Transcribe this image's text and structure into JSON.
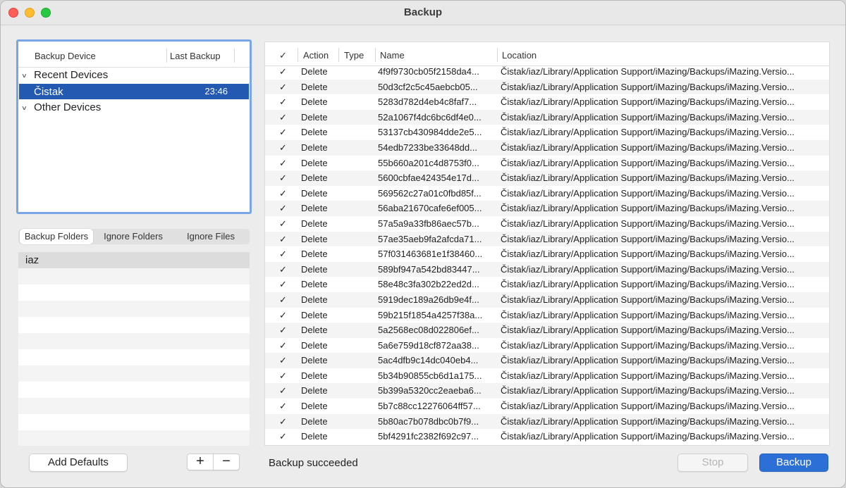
{
  "window": {
    "title": "Backup"
  },
  "devices": {
    "col_device": "Backup Device",
    "col_last_backup": "Last Backup",
    "recent_group": "Recent Devices",
    "selected_device": {
      "name": "Čistak",
      "time": "23:46"
    },
    "other_group": "Other Devices"
  },
  "tabs": [
    "Backup Folders",
    "Ignore Folders",
    "Ignore Files"
  ],
  "folders": [
    "iaz"
  ],
  "buttons": {
    "add_defaults": "Add Defaults",
    "plus": "+",
    "minus": "−",
    "stop": "Stop",
    "backup": "Backup"
  },
  "table": {
    "headers": {
      "check": "✓",
      "action": "Action",
      "type": "Type",
      "name": "Name",
      "location": "Location"
    },
    "rows": [
      {
        "check": "✓",
        "action": "Delete",
        "name": "4f9f9730cb05f2158da4...",
        "location": "Čistak/iaz/Library/Application Support/iMazing/Backups/iMazing.Versio..."
      },
      {
        "check": "✓",
        "action": "Delete",
        "name": "50d3cf2c5c45aebcb05...",
        "location": "Čistak/iaz/Library/Application Support/iMazing/Backups/iMazing.Versio..."
      },
      {
        "check": "✓",
        "action": "Delete",
        "name": "5283d782d4eb4c8faf7...",
        "location": "Čistak/iaz/Library/Application Support/iMazing/Backups/iMazing.Versio..."
      },
      {
        "check": "✓",
        "action": "Delete",
        "name": "52a1067f4dc6bc6df4e0...",
        "location": "Čistak/iaz/Library/Application Support/iMazing/Backups/iMazing.Versio..."
      },
      {
        "check": "✓",
        "action": "Delete",
        "name": "53137cb430984dde2e5...",
        "location": "Čistak/iaz/Library/Application Support/iMazing/Backups/iMazing.Versio..."
      },
      {
        "check": "✓",
        "action": "Delete",
        "name": "54edb7233be33648dd...",
        "location": "Čistak/iaz/Library/Application Support/iMazing/Backups/iMazing.Versio..."
      },
      {
        "check": "✓",
        "action": "Delete",
        "name": "55b660a201c4d8753f0...",
        "location": "Čistak/iaz/Library/Application Support/iMazing/Backups/iMazing.Versio..."
      },
      {
        "check": "✓",
        "action": "Delete",
        "name": "5600cbfae424354e17d...",
        "location": "Čistak/iaz/Library/Application Support/iMazing/Backups/iMazing.Versio..."
      },
      {
        "check": "✓",
        "action": "Delete",
        "name": "569562c27a01c0fbd85f...",
        "location": "Čistak/iaz/Library/Application Support/iMazing/Backups/iMazing.Versio..."
      },
      {
        "check": "✓",
        "action": "Delete",
        "name": "56aba21670cafe6ef005...",
        "location": "Čistak/iaz/Library/Application Support/iMazing/Backups/iMazing.Versio..."
      },
      {
        "check": "✓",
        "action": "Delete",
        "name": "57a5a9a33fb86aec57b...",
        "location": "Čistak/iaz/Library/Application Support/iMazing/Backups/iMazing.Versio..."
      },
      {
        "check": "✓",
        "action": "Delete",
        "name": "57ae35aeb9fa2afcda71...",
        "location": "Čistak/iaz/Library/Application Support/iMazing/Backups/iMazing.Versio..."
      },
      {
        "check": "✓",
        "action": "Delete",
        "name": "57f031463681e1f38460...",
        "location": "Čistak/iaz/Library/Application Support/iMazing/Backups/iMazing.Versio..."
      },
      {
        "check": "✓",
        "action": "Delete",
        "name": "589bf947a542bd83447...",
        "location": "Čistak/iaz/Library/Application Support/iMazing/Backups/iMazing.Versio..."
      },
      {
        "check": "✓",
        "action": "Delete",
        "name": "58e48c3fa302b22ed2d...",
        "location": "Čistak/iaz/Library/Application Support/iMazing/Backups/iMazing.Versio..."
      },
      {
        "check": "✓",
        "action": "Delete",
        "name": "5919dec189a26db9e4f...",
        "location": "Čistak/iaz/Library/Application Support/iMazing/Backups/iMazing.Versio..."
      },
      {
        "check": "✓",
        "action": "Delete",
        "name": "59b215f1854a4257f38a...",
        "location": "Čistak/iaz/Library/Application Support/iMazing/Backups/iMazing.Versio..."
      },
      {
        "check": "✓",
        "action": "Delete",
        "name": "5a2568ec08d022806ef...",
        "location": "Čistak/iaz/Library/Application Support/iMazing/Backups/iMazing.Versio..."
      },
      {
        "check": "✓",
        "action": "Delete",
        "name": "5a6e759d18cf872aa38...",
        "location": "Čistak/iaz/Library/Application Support/iMazing/Backups/iMazing.Versio..."
      },
      {
        "check": "✓",
        "action": "Delete",
        "name": "5ac4dfb9c14dc040eb4...",
        "location": "Čistak/iaz/Library/Application Support/iMazing/Backups/iMazing.Versio..."
      },
      {
        "check": "✓",
        "action": "Delete",
        "name": "5b34b90855cb6d1a175...",
        "location": "Čistak/iaz/Library/Application Support/iMazing/Backups/iMazing.Versio..."
      },
      {
        "check": "✓",
        "action": "Delete",
        "name": "5b399a5320cc2eaeba6...",
        "location": "Čistak/iaz/Library/Application Support/iMazing/Backups/iMazing.Versio..."
      },
      {
        "check": "✓",
        "action": "Delete",
        "name": "5b7c88cc12276064ff57...",
        "location": "Čistak/iaz/Library/Application Support/iMazing/Backups/iMazing.Versio..."
      },
      {
        "check": "✓",
        "action": "Delete",
        "name": "5b80ac7b078dbc0b7f9...",
        "location": "Čistak/iaz/Library/Application Support/iMazing/Backups/iMazing.Versio..."
      },
      {
        "check": "✓",
        "action": "Delete",
        "name": "5bf4291fc2382f692c97...",
        "location": "Čistak/iaz/Library/Application Support/iMazing/Backups/iMazing.Versio..."
      }
    ]
  },
  "status": {
    "text": "Backup succeeded"
  },
  "colors": {
    "accent": "#2c6fd6",
    "selection": "#2359b0",
    "focus_ring": "#7aa6e6"
  }
}
